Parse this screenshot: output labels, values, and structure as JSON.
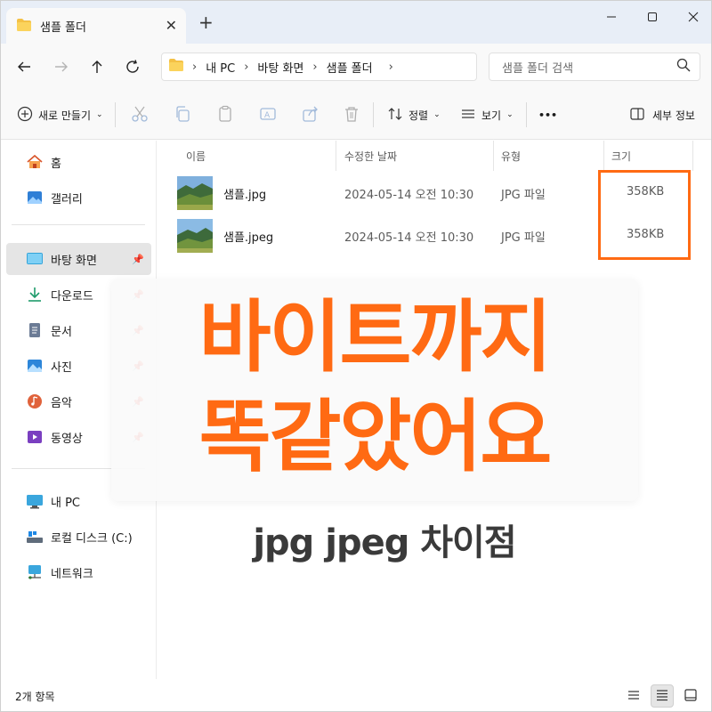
{
  "window": {
    "tab_title": "샘플 폴더",
    "new_tab": "+",
    "close_tab": "✕"
  },
  "nav": {
    "breadcrumbs": [
      "내 PC",
      "바탕 화면",
      "샘플 폴더"
    ],
    "search_placeholder": "샘플 폴더 검색"
  },
  "toolbar": {
    "new_label": "새로 만들기",
    "sort_label": "정렬",
    "view_label": "보기",
    "more_label": "•••",
    "details_label": "세부 정보"
  },
  "sidebar": {
    "items": [
      {
        "label": "홈",
        "icon": "home-icon",
        "pinned": false
      },
      {
        "label": "갤러리",
        "icon": "gallery-icon",
        "pinned": false
      },
      {
        "label": "바탕 화면",
        "icon": "desktop-icon",
        "pinned": true
      },
      {
        "label": "다운로드",
        "icon": "download-icon",
        "pinned": true
      },
      {
        "label": "문서",
        "icon": "documents-icon",
        "pinned": true
      },
      {
        "label": "사진",
        "icon": "pictures-icon",
        "pinned": true
      },
      {
        "label": "음악",
        "icon": "music-icon",
        "pinned": true
      },
      {
        "label": "동영상",
        "icon": "videos-icon",
        "pinned": true
      },
      {
        "label": "내 PC",
        "icon": "pc-icon",
        "pinned": false
      },
      {
        "label": "로컬 디스크 (C:)",
        "icon": "drive-icon",
        "pinned": false
      },
      {
        "label": "네트워크",
        "icon": "network-icon",
        "pinned": false
      }
    ]
  },
  "table": {
    "columns": [
      "이름",
      "수정한 날짜",
      "유형",
      "크기"
    ],
    "rows": [
      {
        "name": "샘플.jpg",
        "date": "2024-05-14 오전 10:30",
        "type": "JPG 파일",
        "size": "358KB"
      },
      {
        "name": "샘플.jpeg",
        "date": "2024-05-14 오전 10:30",
        "type": "JPG 파일",
        "size": "358KB"
      }
    ]
  },
  "overlay": {
    "line1": "바이트까지",
    "line2": "똑같았어요",
    "subtitle": "jpg jpeg 차이점",
    "accent_color": "#ff6a13"
  },
  "status": {
    "item_count": "2개 항목"
  }
}
